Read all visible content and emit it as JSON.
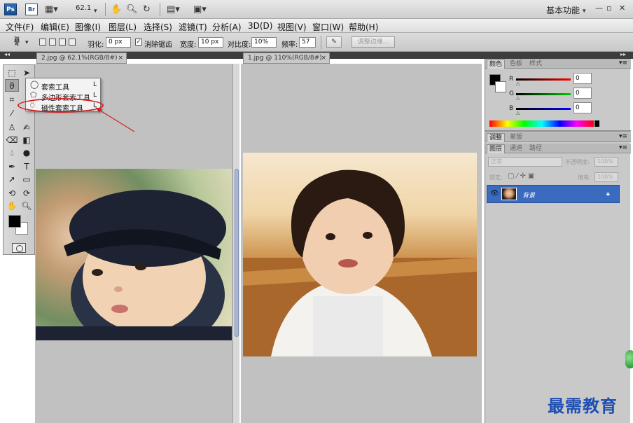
{
  "appbar": {
    "logo": "Ps",
    "bridge": "Br",
    "zoom": "62.1",
    "workspace": "基本功能",
    "win_min": "—",
    "win_restore": "▫",
    "win_close": "✕"
  },
  "menu": [
    "文件(F)",
    "编辑(E)",
    "图像(I)",
    "图层(L)",
    "选择(S)",
    "滤镜(T)",
    "分析(A)",
    "3D(D)",
    "视图(V)",
    "窗口(W)",
    "帮助(H)"
  ],
  "options": {
    "feather_label": "羽化:",
    "feather_value": "0 px",
    "antialias_label": "消除锯齿",
    "width_label": "宽度:",
    "width_value": "10 px",
    "contrast_label": "对比度:",
    "contrast_value": "10%",
    "frequency_label": "频率:",
    "frequency_value": "57",
    "refine_edge": "调整边缘..."
  },
  "flyout": {
    "items": [
      {
        "label": "套索工具",
        "shortcut": "L"
      },
      {
        "label": "多边形套索工具",
        "shortcut": "L"
      },
      {
        "label": "磁性套索工具",
        "shortcut": "L"
      }
    ]
  },
  "documents": [
    {
      "tab": "2.jpg @ 62.1%(RGB/8#)",
      "close": "×"
    },
    {
      "tab": "1.jpg @ 110%(RGB/8#)",
      "close": "×"
    }
  ],
  "color_panel": {
    "tabs": [
      "颜色",
      "色板",
      "样式"
    ],
    "r_label": "R",
    "r_value": "0",
    "g_label": "G",
    "g_value": "0",
    "b_label": "B",
    "b_value": "0"
  },
  "adjust_panel": {
    "tabs": [
      "调整",
      "蒙版"
    ]
  },
  "layers_panel": {
    "tabs": [
      "图层",
      "通道",
      "路径"
    ],
    "blend_mode": "正常",
    "opacity_label": "不透明度:",
    "opacity_value": "100%",
    "lock_label": "锁定:",
    "fill_label": "填充:",
    "fill_value": "100%",
    "layer_name": "背景"
  },
  "watermark": "最需教育"
}
